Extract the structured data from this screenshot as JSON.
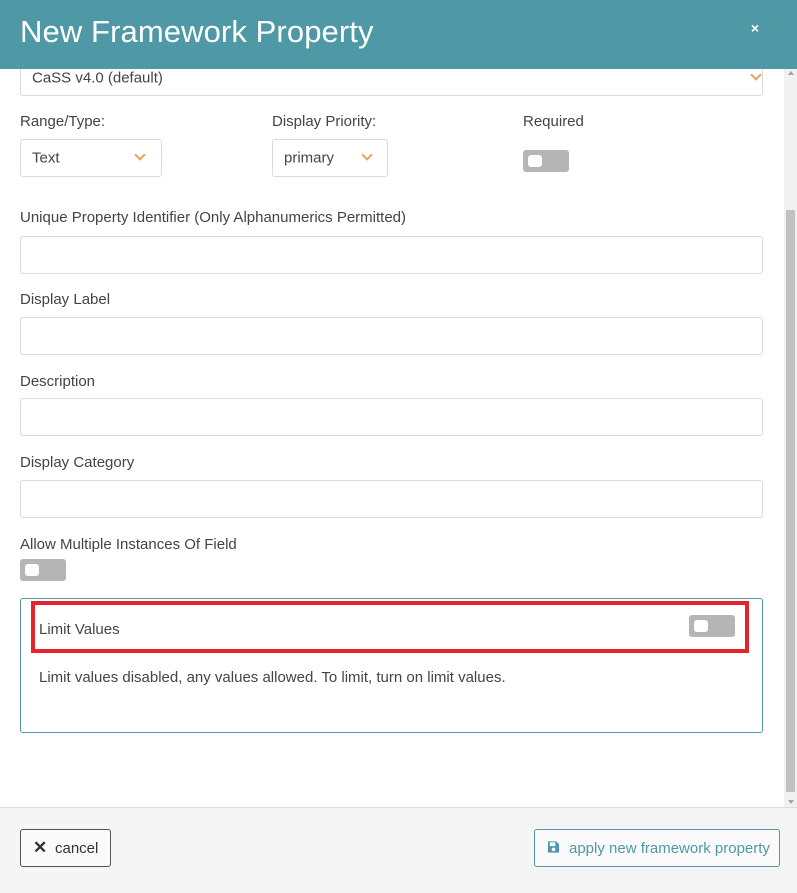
{
  "dialog": {
    "title": "New Framework Property",
    "close_symbol": "×"
  },
  "fields": {
    "version_select": {
      "value": "CaSS v4.0 (default)"
    },
    "range_type": {
      "label": "Range/Type:",
      "value": "Text"
    },
    "display_priority": {
      "label": "Display Priority:",
      "value": "primary"
    },
    "required": {
      "label": "Required",
      "enabled": false
    },
    "unique_identifier": {
      "label": "Unique Property Identifier (Only Alphanumerics Permitted)",
      "value": ""
    },
    "display_label": {
      "label": "Display Label",
      "value": ""
    },
    "description": {
      "label": "Description",
      "value": ""
    },
    "display_category": {
      "label": "Display Category",
      "value": ""
    },
    "allow_multiple": {
      "label": "Allow Multiple Instances Of Field",
      "enabled": false
    }
  },
  "limit_values": {
    "label": "Limit Values",
    "enabled": false,
    "description": "Limit values disabled, any values allowed. To limit, turn on limit values."
  },
  "footer": {
    "cancel_label": "cancel",
    "apply_label": "apply new framework property"
  },
  "colors": {
    "header": "#4f99a6",
    "accent_chevron": "#e8a15c",
    "toggle_off": "#b5b5b5",
    "highlight": "#e3242b"
  },
  "icons": [
    "close-icon",
    "chevron-down-icon",
    "times-icon",
    "save-icon"
  ]
}
